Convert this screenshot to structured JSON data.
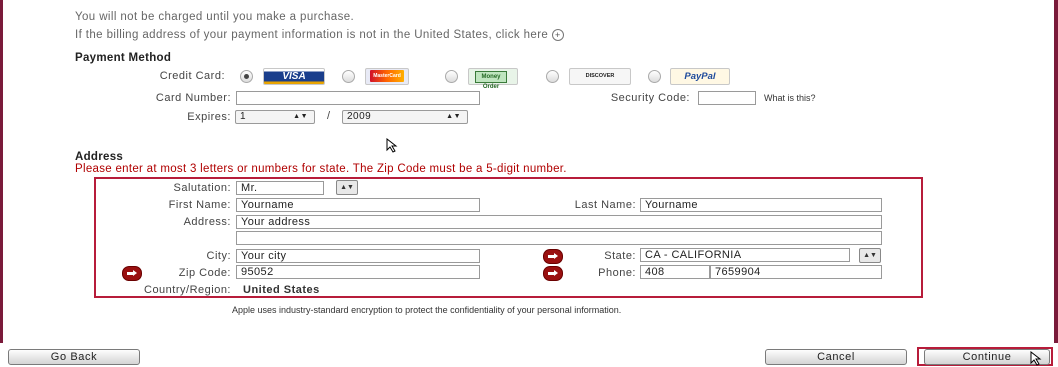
{
  "notices": {
    "charge": "You will not be charged until you make a purchase.",
    "billing": "If the billing address of your payment information is not in the United States, click here"
  },
  "payment": {
    "heading": "Payment Method",
    "credit_card_label": "Credit Card:",
    "cards": [
      {
        "name": "VISA",
        "selected": true
      },
      {
        "name": "MasterCard",
        "selected": false
      },
      {
        "name": "Money Order",
        "selected": false
      },
      {
        "name": "DISCOVER",
        "selected": false
      },
      {
        "name": "PayPal",
        "selected": false
      }
    ],
    "card_number_label": "Card Number:",
    "card_number_value": "",
    "security_code_label": "Security Code:",
    "security_code_value": "",
    "what_is_this": "What is this?",
    "expires_label": "Expires:",
    "expires_month": "1",
    "expires_sep": "/",
    "expires_year": "2009"
  },
  "address": {
    "heading": "Address",
    "error": "Please enter at most 3 letters or numbers for state. The Zip Code must be a 5-digit number.",
    "salutation_label": "Salutation:",
    "salutation_value": "Mr.",
    "first_name_label": "First Name:",
    "first_name_value": "Yourname",
    "last_name_label": "Last Name:",
    "last_name_value": "Yourname",
    "address_label": "Address:",
    "address_line1": "Your address",
    "address_line2": "",
    "city_label": "City:",
    "city_value": "Your city",
    "state_label": "State:",
    "state_value": "CA - CALIFORNIA",
    "zip_label": "Zip Code:",
    "zip_value": "95052",
    "phone_label": "Phone:",
    "phone_area": "408",
    "phone_number": "7659904",
    "country_label": "Country/Region:",
    "country_value": "United States"
  },
  "encryption_note": "Apple uses industry-standard encryption to protect the confidentiality of your personal information.",
  "buttons": {
    "go_back": "Go Back",
    "cancel": "Cancel",
    "continue": "Continue"
  },
  "colors": {
    "frame": "#7a1a3a",
    "error_text": "#b00000",
    "highlight_border": "#b71c3a"
  },
  "icons": [
    "circle-plus-icon",
    "error-arrow-icon",
    "mouse-pointer-icon"
  ]
}
